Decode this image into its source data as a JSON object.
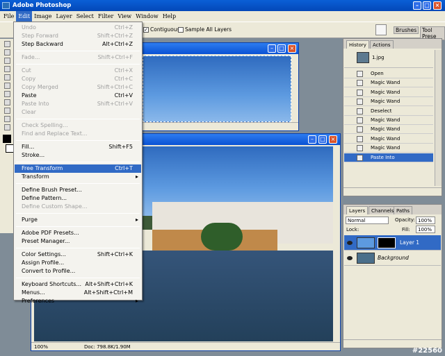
{
  "app": {
    "title": "Adobe Photoshop"
  },
  "menubar": [
    "File",
    "Edit",
    "Image",
    "Layer",
    "Select",
    "Filter",
    "View",
    "Window",
    "Help"
  ],
  "options": {
    "contiguous": "Contiguous",
    "sample_all": "Sample All Layers",
    "tabs": [
      "Brushes",
      "Tool Prese"
    ]
  },
  "edit_menu": [
    {
      "label": "Undo",
      "shortcut": "Ctrl+Z",
      "disabled": true
    },
    {
      "label": "Step Forward",
      "shortcut": "Shift+Ctrl+Z",
      "disabled": true
    },
    {
      "label": "Step Backward",
      "shortcut": "Alt+Ctrl+Z"
    },
    {
      "sep": true
    },
    {
      "label": "Fade...",
      "shortcut": "Shift+Ctrl+F",
      "disabled": true
    },
    {
      "sep": true
    },
    {
      "label": "Cut",
      "shortcut": "Ctrl+X",
      "disabled": true
    },
    {
      "label": "Copy",
      "shortcut": "Ctrl+C",
      "disabled": true
    },
    {
      "label": "Copy Merged",
      "shortcut": "Shift+Ctrl+C",
      "disabled": true
    },
    {
      "label": "Paste",
      "shortcut": "Ctrl+V"
    },
    {
      "label": "Paste Into",
      "shortcut": "Shift+Ctrl+V",
      "disabled": true
    },
    {
      "label": "Clear",
      "disabled": true
    },
    {
      "sep": true
    },
    {
      "label": "Check Spelling...",
      "disabled": true
    },
    {
      "label": "Find and Replace Text...",
      "disabled": true
    },
    {
      "sep": true
    },
    {
      "label": "Fill...",
      "shortcut": "Shift+F5"
    },
    {
      "label": "Stroke..."
    },
    {
      "sep": true
    },
    {
      "label": "Free Transform",
      "shortcut": "Ctrl+T",
      "highlight": true
    },
    {
      "label": "Transform",
      "submenu": true
    },
    {
      "sep": true
    },
    {
      "label": "Define Brush Preset..."
    },
    {
      "label": "Define Pattern..."
    },
    {
      "label": "Define Custom Shape...",
      "disabled": true
    },
    {
      "sep": true
    },
    {
      "label": "Purge",
      "submenu": true
    },
    {
      "sep": true
    },
    {
      "label": "Adobe PDF Presets..."
    },
    {
      "label": "Preset Manager..."
    },
    {
      "sep": true
    },
    {
      "label": "Color Settings...",
      "shortcut": "Shift+Ctrl+K"
    },
    {
      "label": "Assign Profile..."
    },
    {
      "label": "Convert to Profile..."
    },
    {
      "sep": true
    },
    {
      "label": "Keyboard Shortcuts...",
      "shortcut": "Alt+Shift+Ctrl+K"
    },
    {
      "label": "Menus...",
      "shortcut": "Alt+Shift+Ctrl+M"
    },
    {
      "label": "Preferences",
      "submenu": true
    }
  ],
  "doc": {
    "zoom": "100%",
    "size": "Doc: 798.8K/1.90M"
  },
  "history": {
    "tabs": [
      "History",
      "Actions"
    ],
    "snapshot": "1.jpg",
    "items": [
      "Open",
      "Magic Wand",
      "Magic Wand",
      "Magic Wand",
      "Deselect",
      "Magic Wand",
      "Magic Wand",
      "Magic Wand",
      "Magic Wand",
      "Paste Into"
    ]
  },
  "layers": {
    "tabs": [
      "Layers",
      "Channels",
      "Paths"
    ],
    "blend": "Normal",
    "opacity_label": "Opacity:",
    "opacity": "100%",
    "lock_label": "Lock:",
    "fill_label": "Fill:",
    "fill": "100%",
    "rows": [
      "Layer 1",
      "Background"
    ]
  },
  "watermark": "#22560"
}
